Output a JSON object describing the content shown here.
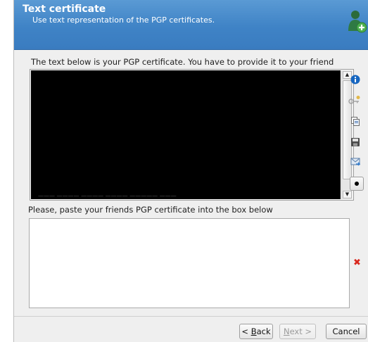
{
  "header": {
    "title": "Text certificate",
    "subtitle": "Use text representation of the PGP certificates.",
    "icon": "add-friend-icon"
  },
  "own_cert": {
    "label": "The text below is your PGP certificate. You have to provide it to your friend",
    "stray_text": "——— ———— ———— ———— ————— ———"
  },
  "friend_cert": {
    "label": "Please, paste your friends PGP certificate into the box below",
    "value": ""
  },
  "side_tools": [
    {
      "name": "info-icon"
    },
    {
      "name": "key-sign-icon"
    },
    {
      "name": "copy-icon"
    },
    {
      "name": "save-icon"
    },
    {
      "name": "send-mail-icon"
    },
    {
      "name": "radio-toggle"
    }
  ],
  "footer": {
    "back_pre": "< ",
    "back_mn": "B",
    "back_post": "ack",
    "next_mn": "N",
    "next_post": "ext >",
    "cancel": "Cancel"
  },
  "colors": {
    "header": "#3f83c6",
    "clear": "#d9281e",
    "info": "#1565c0"
  }
}
